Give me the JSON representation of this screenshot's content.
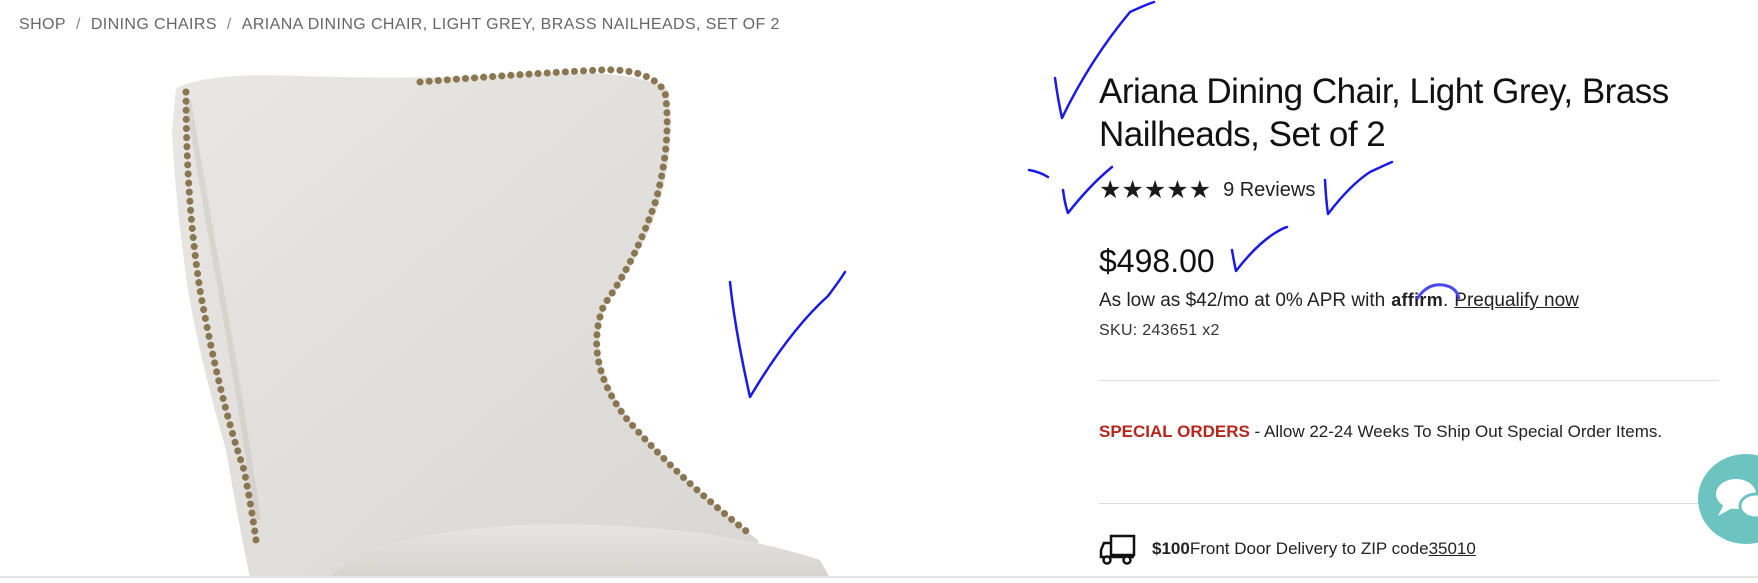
{
  "breadcrumb": {
    "items": [
      "SHOP",
      "DINING CHAIRS",
      "ARIANA DINING CHAIR, LIGHT GREY, BRASS NAILHEADS, SET OF 2"
    ],
    "separator": "/"
  },
  "product": {
    "title_line1": "Ariana Dining Chair, Light Grey, Brass",
    "title_line2": "Nailheads, Set of 2",
    "stars": "★★★★★",
    "rating_value": 5,
    "reviews_label": "9 Reviews",
    "price": "$498.00",
    "financing": {
      "prefix": "As low as $42/mo at 0% APR with",
      "brand": "affirm",
      "suffix": ".",
      "link": "Prequalify now"
    },
    "sku": "SKU: 243651 x2"
  },
  "special_orders": {
    "tag": "SPECIAL ORDERS",
    "text": " - Allow 22-24 Weeks To Ship Out Special Order Items."
  },
  "delivery": {
    "icon": "truck-icon",
    "amount": "$100",
    "text": " Front Door Delivery to ZIP code ",
    "zip": "35010"
  },
  "chat": {
    "icon": "chat-icon"
  },
  "colors": {
    "special_orders_red": "#b5271d",
    "chat_teal": "#6cc3c0",
    "annotation_blue": "#1a1ae6",
    "fabric_grey": "#e3e1de",
    "nailhead_brass": "#8a7650"
  }
}
